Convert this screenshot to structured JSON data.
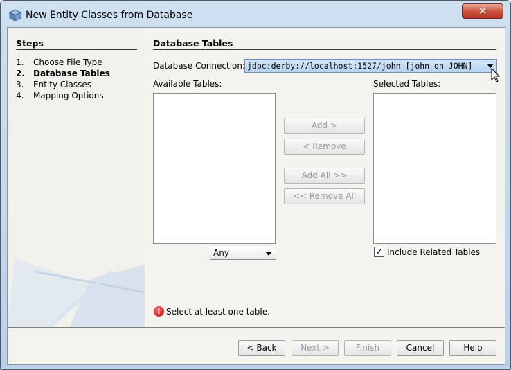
{
  "window": {
    "title": "New Entity Classes from Database",
    "close_label": "✕"
  },
  "steps": {
    "title": "Steps",
    "items": [
      {
        "num": "1.",
        "label": "Choose File Type"
      },
      {
        "num": "2.",
        "label": "Database Tables"
      },
      {
        "num": "3.",
        "label": "Entity Classes"
      },
      {
        "num": "4.",
        "label": "Mapping Options"
      }
    ],
    "current_index": 1
  },
  "panel": {
    "title": "Database Tables",
    "connection_label": "Database Connection:",
    "connection_value": "jdbc:derby://localhost:1527/john [john on JOHN]",
    "available_label": "Available Tables:",
    "selected_label": "Selected Tables:",
    "filter_value": "Any",
    "include_related_label": "Include Related Tables",
    "include_related_checked": true,
    "check_mark": "✓",
    "error_icon_text": "!",
    "message": "Select at least one table."
  },
  "transfer_buttons": {
    "add": "Add >",
    "remove": "< Remove",
    "add_all": "Add All >>",
    "remove_all": "<< Remove All"
  },
  "footer_buttons": {
    "back": "< Back",
    "next": "Next >",
    "finish": "Finish",
    "cancel": "Cancel",
    "help": "Help"
  },
  "colors": {
    "close_button": "#c9503b",
    "combo_highlight": "#b7d2f0",
    "error": "#c40000"
  }
}
